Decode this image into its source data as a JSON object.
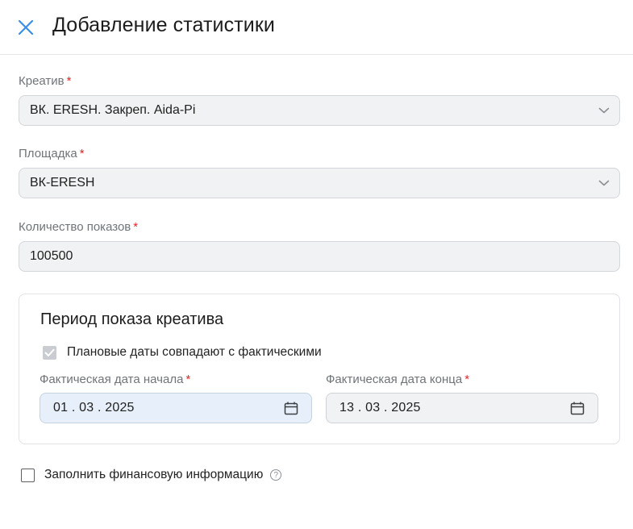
{
  "header": {
    "title": "Добавление статистики",
    "close_icon": "close-icon"
  },
  "fields": {
    "creative": {
      "label": "Креатив",
      "required": "*",
      "value": "ВК. ERESH. Закреп. Aida-Pi"
    },
    "platform": {
      "label": "Площадка",
      "required": "*",
      "value": "ВК-ERESH"
    },
    "impressions": {
      "label": "Количество показов",
      "required": "*",
      "value": "100500"
    }
  },
  "period": {
    "title": "Период показа креатива",
    "plan_matches_label": "Плановые даты совпадают с фактическими",
    "plan_matches_checked": true,
    "start": {
      "label": "Фактическая дата начала",
      "required": "*",
      "value": "01 . 03 . 2025"
    },
    "end": {
      "label": "Фактическая дата конца",
      "required": "*",
      "value": "13 . 03 . 2025"
    }
  },
  "finance": {
    "label": "Заполнить финансовую информацию",
    "checked": false,
    "help": "?"
  },
  "colors": {
    "accent": "#3a8ee6",
    "required": "#e0242b",
    "field_bg": "#f1f2f3",
    "active_date_bg": "#e7f0fa"
  }
}
